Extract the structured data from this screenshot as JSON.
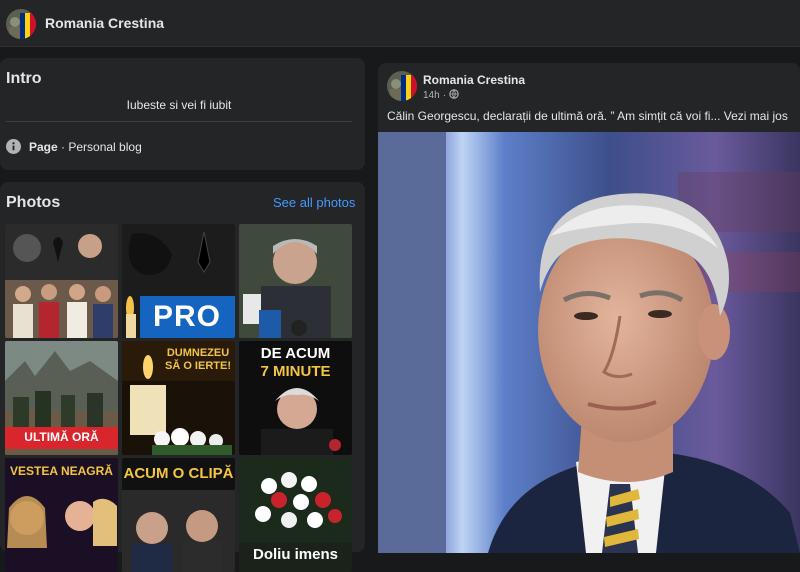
{
  "page": {
    "name": "Romania Crestina"
  },
  "intro": {
    "title": "Intro",
    "bio": "Iubeste si vei fi iubit",
    "category_label": "Page",
    "category_value": "· Personal blog"
  },
  "photos": {
    "title": "Photos",
    "see_all": "See all photos",
    "thumbs": [
      {
        "caption": ""
      },
      {
        "caption": "PRO"
      },
      {
        "caption": ""
      },
      {
        "caption": "ULTIMĂ ORĂ"
      },
      {
        "caption": "DUMNEZEU SĂ O IERTE!"
      },
      {
        "caption_line1": "DE ACUM",
        "caption_line2": "7 MINUTE"
      },
      {
        "caption": "VESTEA NEAGRĂ"
      },
      {
        "caption": "ACUM O CLIPĂ"
      },
      {
        "caption": "Doliu imens"
      }
    ]
  },
  "post": {
    "author": "Romania Crestina",
    "time": "14h",
    "text": "Călin Georgescu, declarații de ultimă oră. ” Am simțit că voi fi... Vezi mai jos"
  },
  "colors": {
    "background": "#18191a",
    "card": "#242526",
    "link": "#4599ff",
    "flag_blue": "#002b7f",
    "flag_yellow": "#fcd116",
    "flag_red": "#ce1126"
  }
}
